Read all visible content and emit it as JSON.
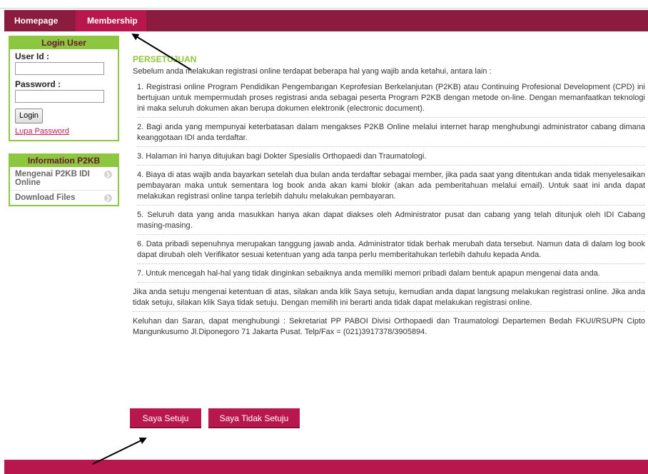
{
  "nav": {
    "items": [
      {
        "label": "Homepage"
      },
      {
        "label": "Membership"
      }
    ]
  },
  "login": {
    "heading": "Login User",
    "userid_label": "User Id :",
    "userid_value": "",
    "password_label": "Password :",
    "password_value": "",
    "button_label": "Login",
    "forgot_link": "Lupa Password"
  },
  "info": {
    "heading": "Information P2KB",
    "items": [
      {
        "label": "Mengenai P2KB IDI Online",
        "icon": "chevron-right-icon"
      },
      {
        "label": "Download Files",
        "icon": "chevron-right-icon"
      }
    ]
  },
  "content": {
    "title": "PERSETUJUAN",
    "intro": "Sebelum anda melakukan registrasi online terdapat beberapa hal yang wajib anda ketahui, antara lain :",
    "items": [
      "1.  Registrasi online Program Pendidikan Pengembangan Keprofesian Berkelanjutan (P2KB) atau Continuing Profesional Development (CPD) ini bertujuan untuk mempermudah proses registrasi anda sebagai peserta Program P2KB dengan metode on-line. Dengan memanfaatkan teknologi ini maka seluruh dokumen akan berupa dokumen elektronik (electronic document).",
      "2.  Bagi anda yang mempunyai keterbatasan dalam mengakses P2KB Online melalui internet harap menghubungi administrator cabang dimana keanggotaan IDI anda terdaftar.",
      "3.  Halaman ini hanya ditujukan bagi Dokter Spesialis Orthopaedi dan Traumatologi.",
      "4.  Biaya di atas wajib anda bayarkan setelah dua bulan anda terdaftar sebagai member, jika pada saat yang ditentukan anda tidak menyelesaikan pembayaran maka untuk sementara log book anda akan kami blokir (akan ada pemberitahuan melalui email). Untuk saat ini anda dapat melakukan registrasi online tanpa terlebih dahulu melakukan pembayaran.",
      "5.  Seluruh data yang anda masukkan hanya akan dapat diakses oleh Administrator pusat dan cabang yang telah ditunjuk oleh IDI Cabang masing-masing.",
      "6.  Data pribadi sepenuhnya merupakan tanggung jawab anda. Administrator tidak berhak merubah data tersebut. Namun data di dalam log book dapat dirubah oleh Verifikator sesuai ketentuan yang ada tanpa perlu memberitahukan terlebih dahulu kepada Anda.",
      "7.  Untuk mencegah hal-hal yang tidak dinginkan sebaiknya anda memiliki memori pribadi dalam bentuk apapun mengenai data anda."
    ],
    "agree_text": "Jika anda setuju mengenai ketentuan di atas, silakan anda klik Saya setuju, kemudian anda dapat langsung melakukan registrasi online. Jika anda tidak setuju, silakan klik Saya tidak setuju. Dengan memilih ini berarti anda tidak dapat melakukan registrasi online.",
    "contact_text": "Keluhan dan Saran, dapat menghubungi : Sekretariat PP PABOI Divisi Orthopaedi dan Traumatologi Departemen Bedah FKUI/RSUPN Cipto Mangunkusumo Jl.Diponegoro 71 Jakarta Pusat. Telp/Fax = (021)3917378/3905894."
  },
  "buttons": {
    "agree": "Saya Setuju",
    "disagree": "Saya Tidak Setuju"
  },
  "colors": {
    "nav_bg": "#8b1c3f",
    "accent": "#b8174d",
    "green": "#8dc63f"
  }
}
